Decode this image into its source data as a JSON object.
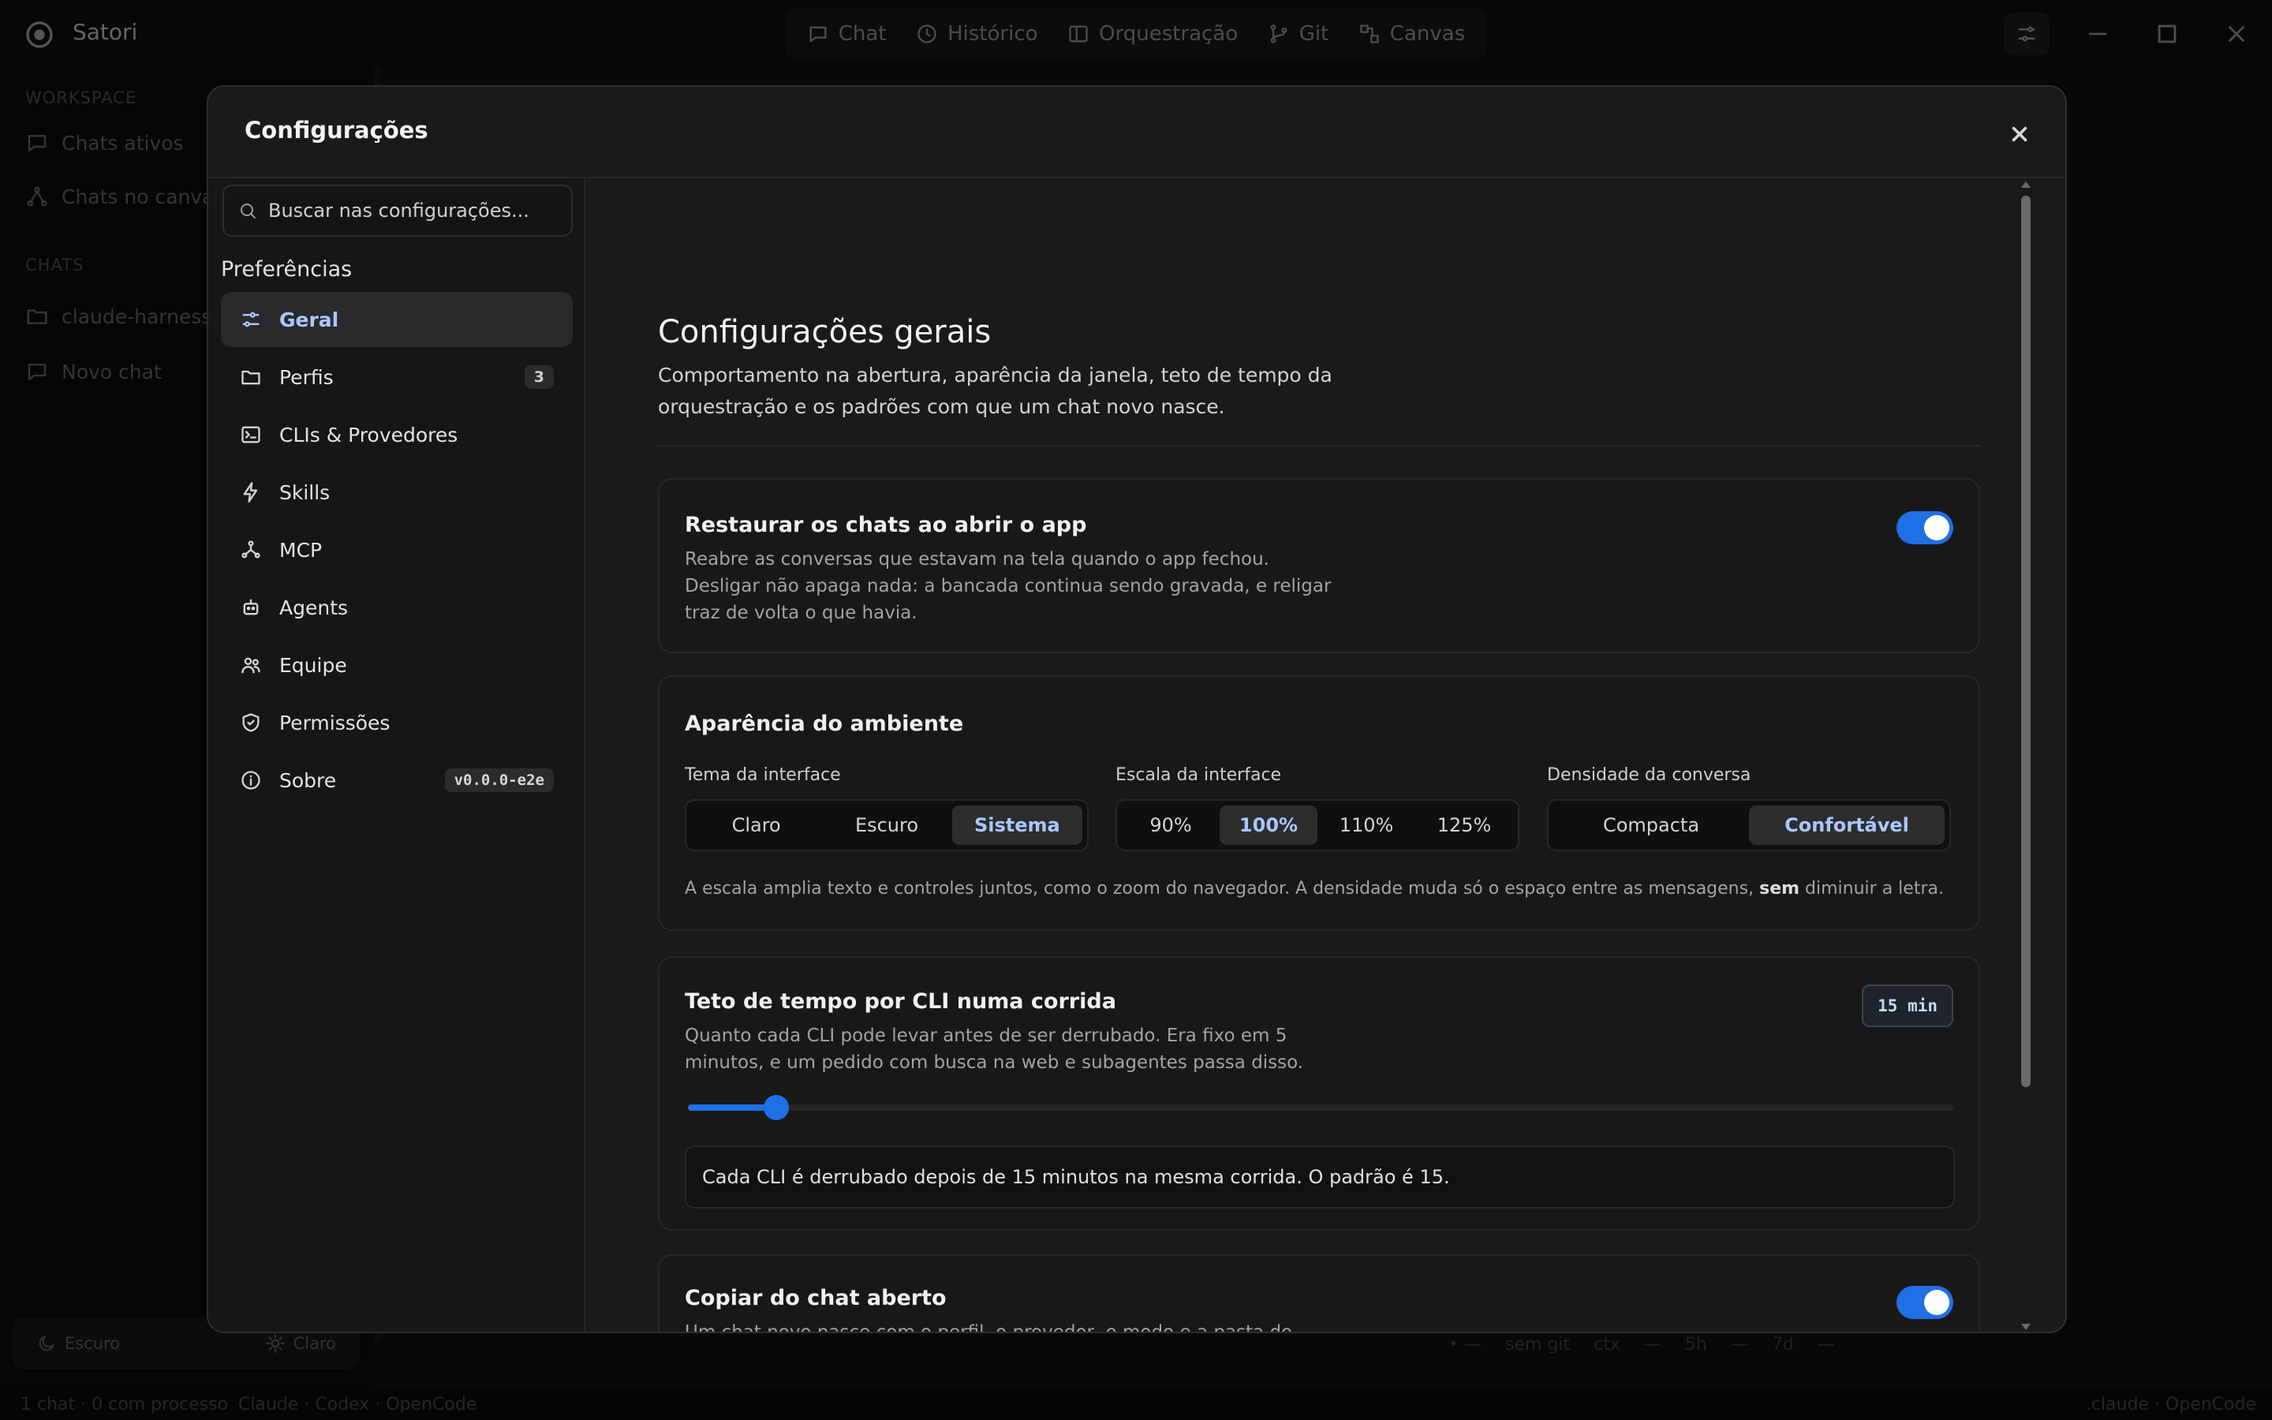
{
  "app": {
    "title": "Satori",
    "nav": [
      "Chat",
      "Histórico",
      "Orquestração",
      "Git",
      "Canvas"
    ]
  },
  "sidebar": {
    "workspace_heading": "WORKSPACE",
    "workspace_items": [
      "Chats ativos",
      "Chats no canvas"
    ],
    "chats_heading": "CHATS",
    "chat_items": [
      "claude-harness",
      "Novo chat"
    ],
    "theme_dark": "Escuro",
    "theme_light": "Claro"
  },
  "statusbar": {
    "left": "1 chat · 0 com processo",
    "engines": "Claude · Codex · OpenCode",
    "right": ".claude · OpenCode",
    "meta": [
      "• —",
      "sem git",
      "ctx",
      "—",
      "5h",
      "—",
      "7d",
      "—"
    ]
  },
  "modal": {
    "title": "Configurações",
    "search_placeholder": "Buscar nas configurações...",
    "section_label": "Preferências",
    "nav": [
      {
        "label": "Geral",
        "icon": "sliders-icon",
        "active": true
      },
      {
        "label": "Perfis",
        "icon": "folder-icon",
        "badge": "3"
      },
      {
        "label": "CLIs & Provedores",
        "icon": "terminal-icon"
      },
      {
        "label": "Skills",
        "icon": "bolt-icon"
      },
      {
        "label": "MCP",
        "icon": "network-icon"
      },
      {
        "label": "Agents",
        "icon": "robot-icon"
      },
      {
        "label": "Equipe",
        "icon": "users-icon"
      },
      {
        "label": "Permissões",
        "icon": "shield-icon"
      },
      {
        "label": "Sobre",
        "icon": "info-icon",
        "badge": "v0.0.0-e2e"
      }
    ]
  },
  "general": {
    "heading": "Configurações gerais",
    "description": "Comportamento na abertura, aparência da janela, teto de tempo da orquestração e os padrões com que um chat novo nasce.",
    "restore": {
      "title": "Restaurar os chats ao abrir o app",
      "description": "Reabre as conversas que estavam na tela quando o app fechou. Desligar não apaga nada: a bancada continua sendo gravada, e religar traz de volta o que havia.",
      "enabled": true
    },
    "appearance": {
      "title": "Aparência do ambiente",
      "theme_label": "Tema da interface",
      "theme_options": [
        "Claro",
        "Escuro",
        "Sistema"
      ],
      "theme_selected": "Sistema",
      "scale_label": "Escala da interface",
      "scale_options": [
        "90%",
        "100%",
        "110%",
        "125%"
      ],
      "scale_selected": "100%",
      "density_label": "Densidade da conversa",
      "density_options": [
        "Compacta",
        "Confortável"
      ],
      "density_selected": "Confortável",
      "note_before": "A escala amplia texto e controles juntos, como o zoom do navegador. A densidade muda só o espaço entre as mensagens,",
      "note_bold": "sem",
      "note_after": "diminuir a letra."
    },
    "timeout": {
      "title": "Teto de tempo por CLI numa corrida",
      "description": "Quanto cada CLI pode levar antes de ser derrubado. Era fixo em 5 minutos, e um pedido com busca na web e subagentes passa disso.",
      "badge": "15 min",
      "slider_fraction": 0.07,
      "info": "Cada CLI é derrubado depois de 15 minutos na mesma corrida. O padrão é 15."
    },
    "copy": {
      "title": "Copiar do chat aberto",
      "description": "Um chat novo nasce com o perfil, o provedor, o modo e a pasta do chat em que você está. Desligue para que todo chat comece igual, com os padrões abaixo.",
      "enabled": true
    }
  },
  "colors": {
    "accent": "#1f6fe5",
    "accent_text": "#a9c7ff"
  }
}
